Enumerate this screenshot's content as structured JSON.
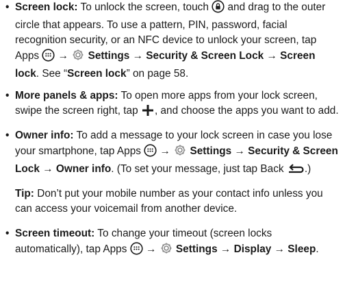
{
  "items": [
    {
      "term": "Screen lock:",
      "t1": " To unlock the screen, touch ",
      "t2": " and drag to the outer circle that appears. To use a pattern, PIN, password, facial recognition security, or an NFC device to unlock your screen, tap Apps ",
      "sep1": " → ",
      "settings": "Settings",
      "sep2": " → ",
      "security": "Security & Screen Lock",
      "sep3": " → ",
      "screenlock": "Screen lock",
      "t3": ". See “",
      "ref": "Screen lock",
      "t4": "” on page 58."
    },
    {
      "term": "More panels & apps:",
      "t1": " To open more apps from your lock screen, swipe the screen right, tap ",
      "t2": ", and choose the apps you want to add."
    },
    {
      "term": "Owner info:",
      "t1": " To add a message to your lock screen in case you lose your smartphone, tap Apps ",
      "sep1": " → ",
      "settings": "Settings",
      "sep2": " → ",
      "security": "Security & Screen Lock",
      "sep3": " → ",
      "owner": "Owner info",
      "t2": ". (To set your message, just tap Back ",
      "t3": ".)"
    },
    {
      "term": "Screen timeout:",
      "t1": " To change your timeout (screen locks automatically), tap Apps ",
      "sep1": " → ",
      "settings": "Settings",
      "sep2": " → ",
      "display": "Display",
      "sep3": " → ",
      "sleep": "Sleep",
      "t2": "."
    }
  ],
  "tip": {
    "label": "Tip:",
    "text": " Don’t put your mobile number as your contact info unless you can access your voicemail from another device."
  },
  "bullet": "•",
  "icons": [
    "lock-icon",
    "apps-icon",
    "settings-gear-icon",
    "plus-icon",
    "back-icon"
  ]
}
